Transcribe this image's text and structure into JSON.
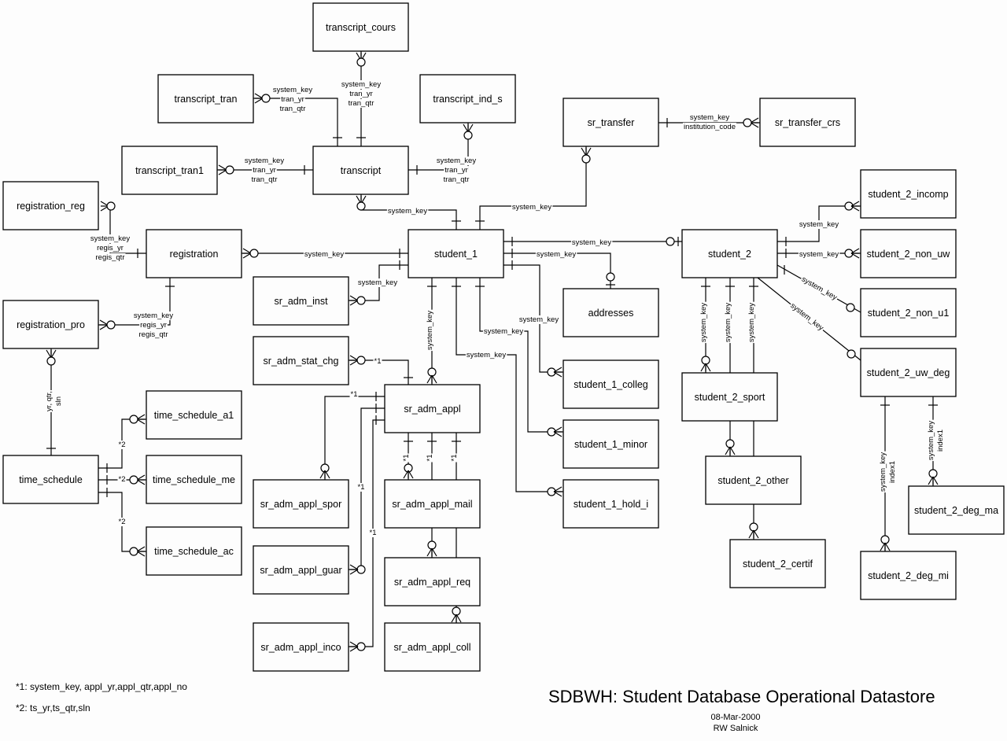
{
  "diagram": {
    "title": "SDBWH: Student Database Operational Datastore",
    "date": "08-Mar-2000",
    "author": "RW Salnick",
    "notes": [
      "*1: system_key, appl_yr,appl_qtr,appl_no",
      "*2: ts_yr,ts_qtr,sln"
    ]
  },
  "entities": {
    "transcript_cours": "transcript_cours",
    "transcript_tran": "transcript_tran",
    "transcript_ind_s": "transcript_ind_s",
    "transcript_tran1": "transcript_tran1",
    "transcript": "transcript",
    "sr_transfer": "sr_transfer",
    "sr_transfer_crs": "sr_transfer_crs",
    "registration_reg": "registration_reg",
    "registration": "registration",
    "registration_pro": "registration_pro",
    "student_1": "student_1",
    "student_2": "student_2",
    "sr_adm_inst": "sr_adm_inst",
    "sr_adm_stat_chg": "sr_adm_stat_chg",
    "sr_adm_appl": "sr_adm_appl",
    "addresses": "addresses",
    "student_1_colleg": "student_1_colleg",
    "student_1_minor": "student_1_minor",
    "student_1_hold_i": "student_1_hold_i",
    "student_2_incomp": "student_2_incomp",
    "student_2_non_uw": "student_2_non_uw",
    "student_2_non_u1": "student_2_non_u1",
    "student_2_uw_deg": "student_2_uw_deg",
    "student_2_sport": "student_2_sport",
    "student_2_other": "student_2_other",
    "student_2_certif": "student_2_certif",
    "student_2_deg_ma": "student_2_deg_ma",
    "student_2_deg_mi": "student_2_deg_mi",
    "time_schedule": "time_schedule",
    "time_schedule_a1": "time_schedule_a1",
    "time_schedule_me": "time_schedule_me",
    "time_schedule_ac": "time_schedule_ac",
    "sr_adm_appl_spor": "sr_adm_appl_spor",
    "sr_adm_appl_guar": "sr_adm_appl_guar",
    "sr_adm_appl_inco": "sr_adm_appl_inco",
    "sr_adm_appl_mail": "sr_adm_appl_mail",
    "sr_adm_appl_req": "sr_adm_appl_req",
    "sr_adm_appl_coll": "sr_adm_appl_coll"
  },
  "labels": {
    "system_key": "system_key",
    "tran_yr": "tran_yr",
    "tran_qtr": "tran_qtr",
    "regis_yr": "regis_yr",
    "regis_qtr": "regis_qtr",
    "institution_code": "institution_code",
    "index1": "index1",
    "yr_qtr": "yr, qtr,",
    "sln": "sln",
    "ref1": "*1",
    "ref2": "*2"
  }
}
